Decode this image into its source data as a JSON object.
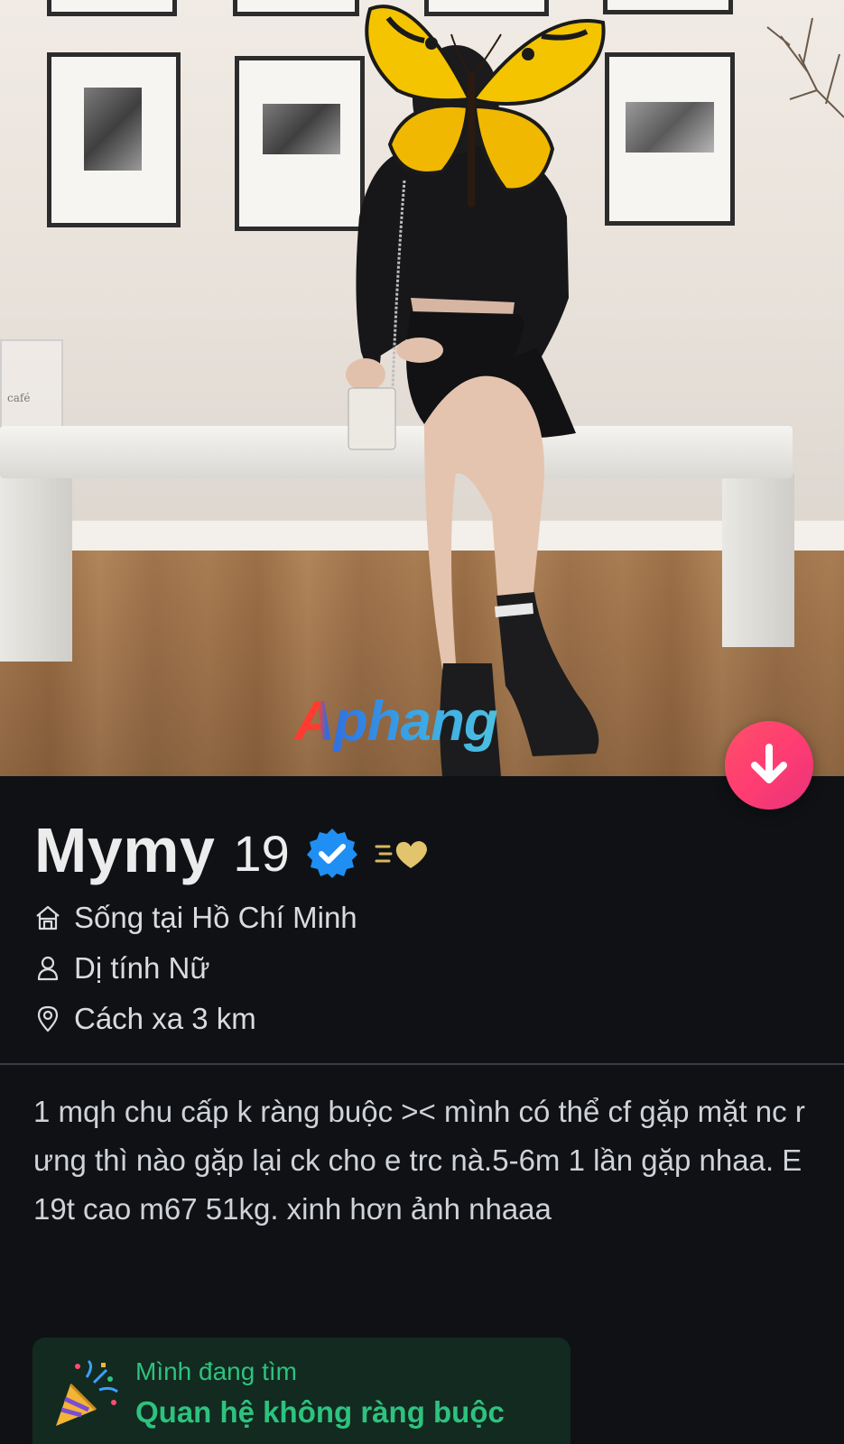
{
  "watermark": "Aphang",
  "photo_frame_caption": "café",
  "profile": {
    "name": "Mymy",
    "age": "19"
  },
  "details": {
    "lives_in": "Sống tại Hồ Chí Minh",
    "orientation": "Dị tính Nữ",
    "distance": "Cách xa 3 km"
  },
  "bio": "1 mqh chu cấp k ràng buộc >< mình có thể cf gặp mặt nc r ưng thì nào gặp lại ck cho e trc nà.5-6m 1 lần gặp nhaa. E 19t cao m67 51kg. xinh hơn ảnh nhaaa",
  "looking_for": {
    "label": "Mình đang tìm",
    "value": "Quan hệ không ràng buộc"
  },
  "icons": {
    "down_button": "arrow-down-icon",
    "verified": "verified-check-icon",
    "badge": "golden-heart-icon",
    "home": "home-icon",
    "orientation": "person-icon",
    "location": "location-pin-icon",
    "party": "party-popper-icon"
  },
  "colors": {
    "background": "#0f1115",
    "accent_gradient_start": "#fd5068",
    "accent_gradient_end": "#e8337a",
    "verified_blue": "#1f8ff4",
    "looking_for_green": "#2ec27e"
  }
}
